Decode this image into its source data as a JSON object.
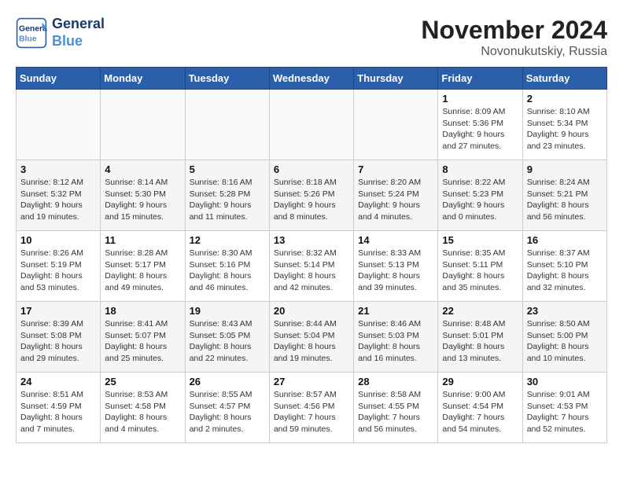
{
  "header": {
    "logo_line1": "General",
    "logo_line2": "Blue",
    "month": "November 2024",
    "location": "Novonukutskiy, Russia"
  },
  "weekdays": [
    "Sunday",
    "Monday",
    "Tuesday",
    "Wednesday",
    "Thursday",
    "Friday",
    "Saturday"
  ],
  "weeks": [
    [
      {
        "day": "",
        "info": ""
      },
      {
        "day": "",
        "info": ""
      },
      {
        "day": "",
        "info": ""
      },
      {
        "day": "",
        "info": ""
      },
      {
        "day": "",
        "info": ""
      },
      {
        "day": "1",
        "info": "Sunrise: 8:09 AM\nSunset: 5:36 PM\nDaylight: 9 hours\nand 27 minutes."
      },
      {
        "day": "2",
        "info": "Sunrise: 8:10 AM\nSunset: 5:34 PM\nDaylight: 9 hours\nand 23 minutes."
      }
    ],
    [
      {
        "day": "3",
        "info": "Sunrise: 8:12 AM\nSunset: 5:32 PM\nDaylight: 9 hours\nand 19 minutes."
      },
      {
        "day": "4",
        "info": "Sunrise: 8:14 AM\nSunset: 5:30 PM\nDaylight: 9 hours\nand 15 minutes."
      },
      {
        "day": "5",
        "info": "Sunrise: 8:16 AM\nSunset: 5:28 PM\nDaylight: 9 hours\nand 11 minutes."
      },
      {
        "day": "6",
        "info": "Sunrise: 8:18 AM\nSunset: 5:26 PM\nDaylight: 9 hours\nand 8 minutes."
      },
      {
        "day": "7",
        "info": "Sunrise: 8:20 AM\nSunset: 5:24 PM\nDaylight: 9 hours\nand 4 minutes."
      },
      {
        "day": "8",
        "info": "Sunrise: 8:22 AM\nSunset: 5:23 PM\nDaylight: 9 hours\nand 0 minutes."
      },
      {
        "day": "9",
        "info": "Sunrise: 8:24 AM\nSunset: 5:21 PM\nDaylight: 8 hours\nand 56 minutes."
      }
    ],
    [
      {
        "day": "10",
        "info": "Sunrise: 8:26 AM\nSunset: 5:19 PM\nDaylight: 8 hours\nand 53 minutes."
      },
      {
        "day": "11",
        "info": "Sunrise: 8:28 AM\nSunset: 5:17 PM\nDaylight: 8 hours\nand 49 minutes."
      },
      {
        "day": "12",
        "info": "Sunrise: 8:30 AM\nSunset: 5:16 PM\nDaylight: 8 hours\nand 46 minutes."
      },
      {
        "day": "13",
        "info": "Sunrise: 8:32 AM\nSunset: 5:14 PM\nDaylight: 8 hours\nand 42 minutes."
      },
      {
        "day": "14",
        "info": "Sunrise: 8:33 AM\nSunset: 5:13 PM\nDaylight: 8 hours\nand 39 minutes."
      },
      {
        "day": "15",
        "info": "Sunrise: 8:35 AM\nSunset: 5:11 PM\nDaylight: 8 hours\nand 35 minutes."
      },
      {
        "day": "16",
        "info": "Sunrise: 8:37 AM\nSunset: 5:10 PM\nDaylight: 8 hours\nand 32 minutes."
      }
    ],
    [
      {
        "day": "17",
        "info": "Sunrise: 8:39 AM\nSunset: 5:08 PM\nDaylight: 8 hours\nand 29 minutes."
      },
      {
        "day": "18",
        "info": "Sunrise: 8:41 AM\nSunset: 5:07 PM\nDaylight: 8 hours\nand 25 minutes."
      },
      {
        "day": "19",
        "info": "Sunrise: 8:43 AM\nSunset: 5:05 PM\nDaylight: 8 hours\nand 22 minutes."
      },
      {
        "day": "20",
        "info": "Sunrise: 8:44 AM\nSunset: 5:04 PM\nDaylight: 8 hours\nand 19 minutes."
      },
      {
        "day": "21",
        "info": "Sunrise: 8:46 AM\nSunset: 5:03 PM\nDaylight: 8 hours\nand 16 minutes."
      },
      {
        "day": "22",
        "info": "Sunrise: 8:48 AM\nSunset: 5:01 PM\nDaylight: 8 hours\nand 13 minutes."
      },
      {
        "day": "23",
        "info": "Sunrise: 8:50 AM\nSunset: 5:00 PM\nDaylight: 8 hours\nand 10 minutes."
      }
    ],
    [
      {
        "day": "24",
        "info": "Sunrise: 8:51 AM\nSunset: 4:59 PM\nDaylight: 8 hours\nand 7 minutes."
      },
      {
        "day": "25",
        "info": "Sunrise: 8:53 AM\nSunset: 4:58 PM\nDaylight: 8 hours\nand 4 minutes."
      },
      {
        "day": "26",
        "info": "Sunrise: 8:55 AM\nSunset: 4:57 PM\nDaylight: 8 hours\nand 2 minutes."
      },
      {
        "day": "27",
        "info": "Sunrise: 8:57 AM\nSunset: 4:56 PM\nDaylight: 7 hours\nand 59 minutes."
      },
      {
        "day": "28",
        "info": "Sunrise: 8:58 AM\nSunset: 4:55 PM\nDaylight: 7 hours\nand 56 minutes."
      },
      {
        "day": "29",
        "info": "Sunrise: 9:00 AM\nSunset: 4:54 PM\nDaylight: 7 hours\nand 54 minutes."
      },
      {
        "day": "30",
        "info": "Sunrise: 9:01 AM\nSunset: 4:53 PM\nDaylight: 7 hours\nand 52 minutes."
      }
    ]
  ]
}
